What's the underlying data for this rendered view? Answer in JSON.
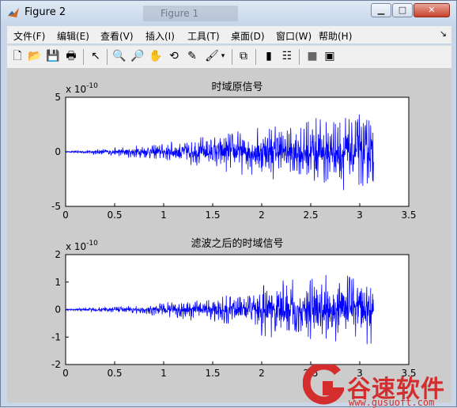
{
  "window": {
    "title": "Figure 2",
    "ghost_title": "Figure 1"
  },
  "menu": [
    "文件(F)",
    "编辑(E)",
    "查看(V)",
    "插入(I)",
    "工具(T)",
    "桌面(D)",
    "窗口(W)",
    "帮助(H)"
  ],
  "toolbar_icons": [
    "new-file-icon",
    "open-folder-icon",
    "save-icon",
    "print-icon",
    "pointer-icon",
    "zoom-in-icon",
    "zoom-out-icon",
    "pan-hand-icon",
    "rotate-3d-icon",
    "data-cursor-icon",
    "brush-icon",
    "link-plot-icon",
    "colorbar-icon",
    "legend-icon",
    "hide-plot-tools-icon",
    "show-plot-tools-icon"
  ],
  "colors": {
    "line": "#0000ff",
    "figure_bg": "#cccccc"
  },
  "watermark": {
    "text": "谷速软件",
    "url": "www.gusuoft.com"
  },
  "chart_data": [
    {
      "type": "line",
      "title": "时域原信号",
      "exponent": "x 10",
      "exponent_power": "-10",
      "xlim": [
        0,
        3.5
      ],
      "ylim": [
        -5,
        5
      ],
      "xticks": [
        "0",
        "0.5",
        "1",
        "1.5",
        "2",
        "2.5",
        "3",
        "3.5"
      ],
      "yticks": [
        "5",
        "0",
        "-5"
      ],
      "x_end": 3.14,
      "envelope": [
        [
          0,
          0.05
        ],
        [
          0.5,
          0.4
        ],
        [
          1,
          0.9
        ],
        [
          1.5,
          1.7
        ],
        [
          2,
          2.4
        ],
        [
          2.5,
          3.2
        ],
        [
          3.14,
          3.8
        ]
      ]
    },
    {
      "type": "line",
      "title": "滤波之后的时域信号",
      "exponent": "x 10",
      "exponent_power": "-10",
      "xlim": [
        0,
        3.5
      ],
      "ylim": [
        -2,
        2
      ],
      "xticks": [
        "0",
        "0.5",
        "1",
        "1.5",
        "2",
        "2.5",
        "3",
        "3.5"
      ],
      "yticks": [
        "2",
        "1",
        "0",
        "-1",
        "-2"
      ],
      "x_end": 3.14,
      "envelope": [
        [
          0,
          0.03
        ],
        [
          0.5,
          0.12
        ],
        [
          1,
          0.25
        ],
        [
          1.5,
          0.55
        ],
        [
          1.9,
          0.6
        ],
        [
          2,
          1.2
        ],
        [
          2.5,
          1.3
        ],
        [
          3.14,
          1.4
        ]
      ]
    }
  ]
}
